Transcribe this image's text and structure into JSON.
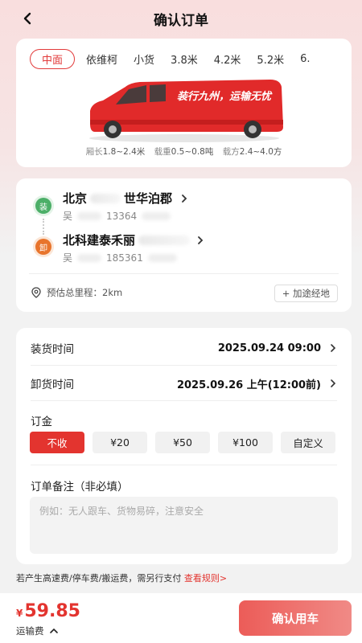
{
  "header": {
    "title": "确认订单"
  },
  "vehicle_tabs": [
    "中面",
    "依维柯",
    "小货",
    "3.8米",
    "4.2米",
    "5.2米",
    "6."
  ],
  "vehicle": {
    "banner_text": "装行九州，运输无忧",
    "specs": [
      {
        "label": "厢长",
        "value": "1.8~2.4米"
      },
      {
        "label": "载重",
        "value": "0.5~0.8吨"
      },
      {
        "label": "载方",
        "value": "2.4~4.0方"
      }
    ]
  },
  "route": {
    "load_badge": "装",
    "unload_badge": "卸",
    "load_address_prefix": "北京",
    "load_address_suffix": "世华泊郡",
    "load_contact_name": "吴",
    "load_contact_phone": "13364",
    "unload_address": "北科建泰禾丽",
    "unload_contact_name": "吴",
    "unload_contact_phone": "185361",
    "distance_label": "预估总里程：2km",
    "add_waypoint": "+ 加途经地"
  },
  "order": {
    "load_time_label": "装货时间",
    "load_time_value": "2025.09.24 09:00",
    "unload_time_label": "卸货时间",
    "unload_time_value": "2025.09.26 上午(12:00前)",
    "deposit_label": "订金",
    "deposit_options": [
      "不收",
      "¥20",
      "¥50",
      "¥100",
      "自定义"
    ],
    "remark_label": "订单备注（非必填）",
    "remark_placeholder": "例如：无人跟车、货物易碎，注意安全"
  },
  "notice": {
    "text": "若产生高速费/停车费/搬运费，需另行支付",
    "link": "查看规则>"
  },
  "footer": {
    "currency": "¥",
    "price": "59.85",
    "price_label": "运输费",
    "confirm_label": "确认用车"
  },
  "colors": {
    "accent": "#e3342f",
    "load": "#4caf68",
    "unload": "#e8742c"
  }
}
